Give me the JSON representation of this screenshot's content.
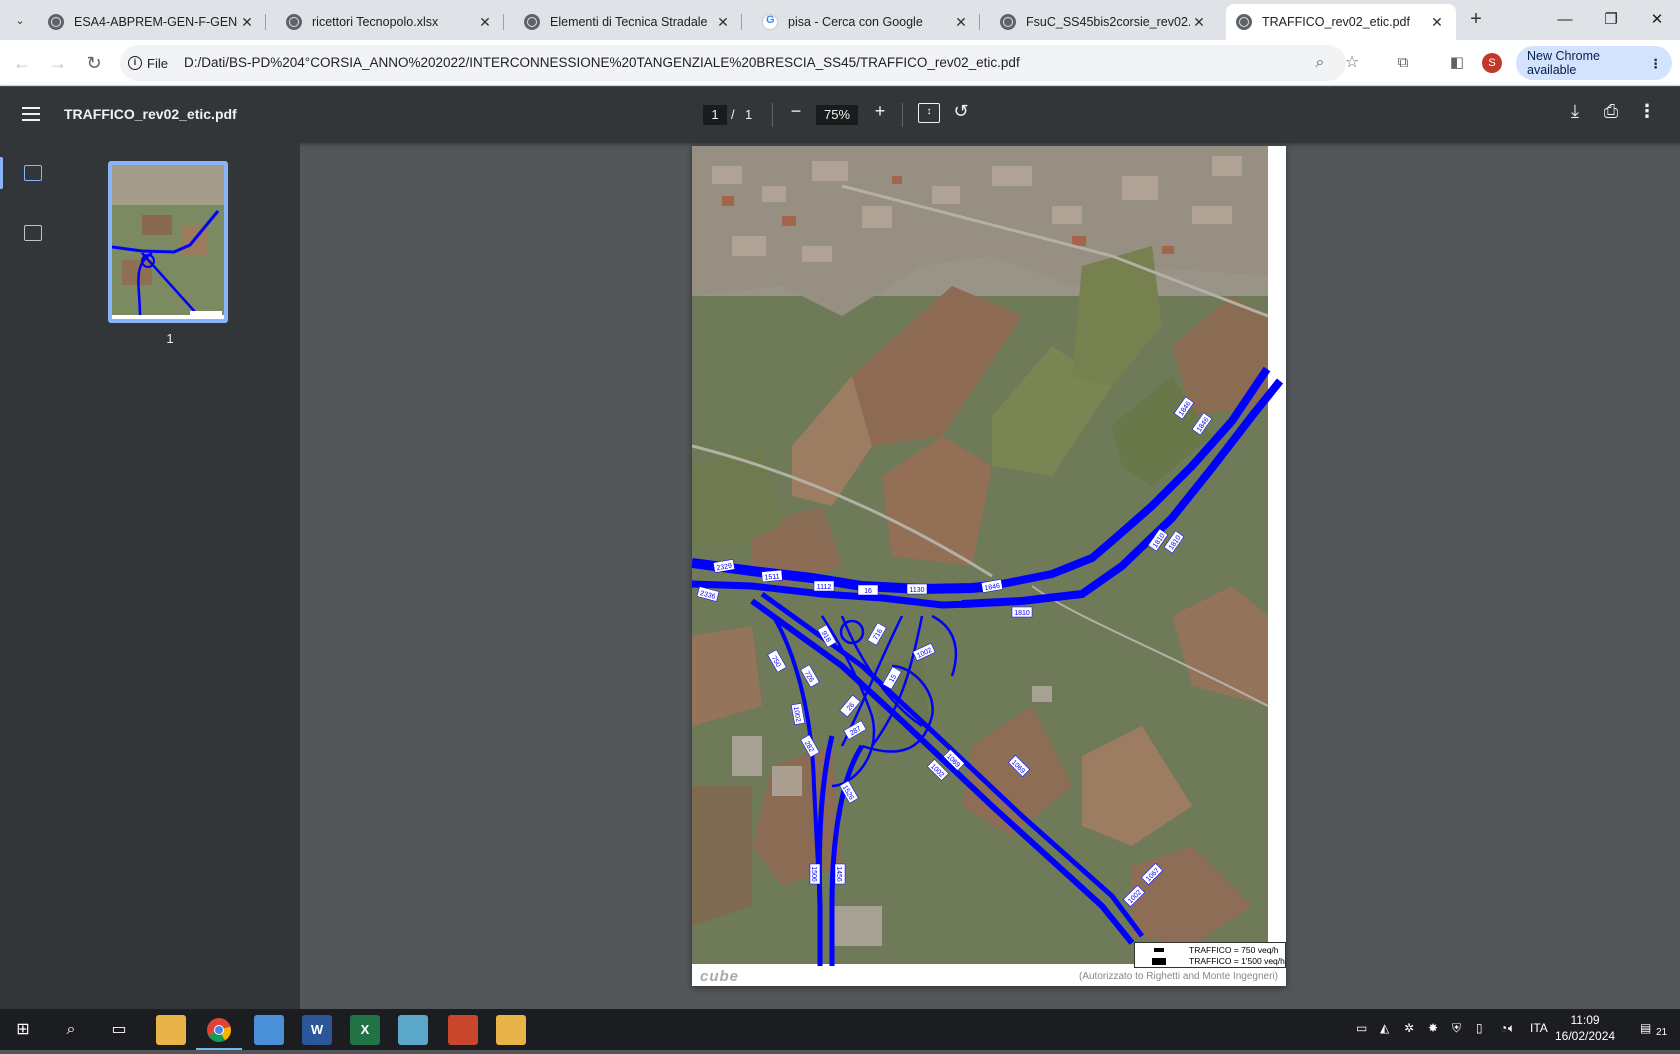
{
  "tabs": [
    {
      "title": "ESA4-ABPREM-GEN-F-GEN-GEN",
      "icon": "globe-icon"
    },
    {
      "title": "ricettori Tecnopolo.xlsx",
      "icon": "globe-icon"
    },
    {
      "title": "Elementi di Tecnica Stradale",
      "icon": "globe-icon"
    },
    {
      "title": "pisa - Cerca con Google",
      "icon": "google-icon"
    },
    {
      "title": "FsuC_SS45bis2corsie_rev02.pdf",
      "icon": "globe-icon"
    },
    {
      "title": "TRAFFICO_rev02_etic.pdf",
      "icon": "globe-icon",
      "active": true
    }
  ],
  "address": {
    "chip_label": "File",
    "url": "D:/Dati/BS-PD%204°CORSIA_ANNO%202022/INTERCONNESSIONE%20TANGENZIALE%20BRESCIA_SS45/TRAFFICO_rev02_etic.pdf",
    "profile_initial": "S",
    "update_label": "New Chrome available"
  },
  "viewer": {
    "file_title": "TRAFFICO_rev02_etic.pdf",
    "current_page": "1",
    "page_separator": "/",
    "total_pages": "1",
    "zoom": "75%",
    "thumbnail_label": "1"
  },
  "document": {
    "flow_labels": [
      "2329",
      "1511",
      "1112",
      "16",
      "1130",
      "1846",
      "2336",
      "918",
      "716",
      "1002",
      "1810",
      "1846",
      "1810",
      "1846",
      "1810",
      "1069",
      "1002",
      "750",
      "726",
      "15",
      "26",
      "1002",
      "287",
      "282",
      "1067",
      "1069",
      "1067",
      "1002",
      "1506",
      "1456",
      "1526"
    ],
    "legend": [
      {
        "label": "TRAFFICO = 750 veq/h"
      },
      {
        "label": "TRAFFICO = 1'500 veq/h"
      }
    ],
    "logo_text": "cube",
    "credit": "(Autorizzato to Righetti and Monte Ingegneri)"
  },
  "taskbar": {
    "language": "ITA",
    "time": "11:09",
    "date": "16/02/2024",
    "notifications": "21"
  },
  "colors": {
    "traffic_band": "#0000ff",
    "viewer_bg": "#525659",
    "toolbar_bg": "#323639",
    "accent": "#8ab4f8"
  }
}
